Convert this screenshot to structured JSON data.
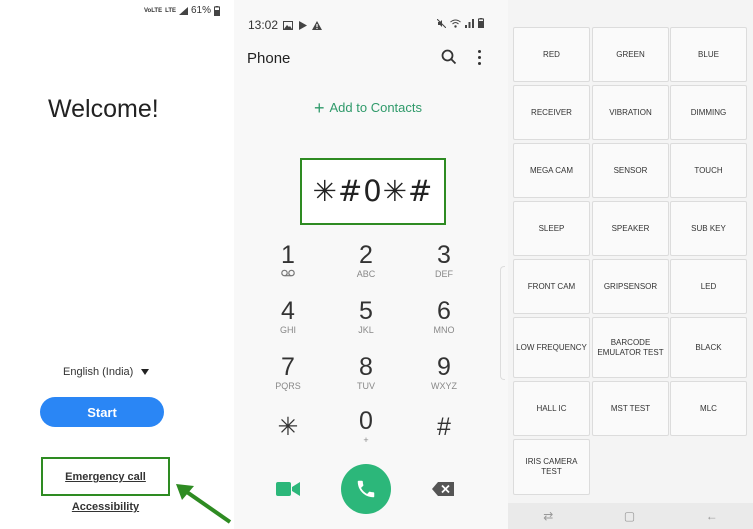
{
  "welcome": {
    "status": {
      "sim_tiny_1": "VoLTE",
      "sim_tiny_2": "LTE",
      "signal_icon": "signal-icon",
      "battery_percent": "61%"
    },
    "title": "Welcome!",
    "language": "English (India)",
    "start_label": "Start",
    "emergency_label": "Emergency call",
    "accessibility_label": "Accessibility"
  },
  "phone": {
    "status": {
      "time": "13:02",
      "left_icons": [
        "image-icon",
        "play-store-icon",
        "warning-icon"
      ],
      "right_icons": [
        "mute-icon",
        "wifi-icon",
        "signal-icon",
        "battery-icon"
      ]
    },
    "app_title": "Phone",
    "add_to_contacts": "Add to Contacts",
    "dialed": "✳#0✳#",
    "keys": [
      {
        "digit": "1",
        "letters": ""
      },
      {
        "digit": "2",
        "letters": "ABC"
      },
      {
        "digit": "3",
        "letters": "DEF"
      },
      {
        "digit": "4",
        "letters": "GHI"
      },
      {
        "digit": "5",
        "letters": "JKL"
      },
      {
        "digit": "6",
        "letters": "MNO"
      },
      {
        "digit": "7",
        "letters": "PQRS"
      },
      {
        "digit": "8",
        "letters": "TUV"
      },
      {
        "digit": "9",
        "letters": "WXYZ"
      },
      {
        "digit": "✳",
        "letters": ""
      },
      {
        "digit": "0",
        "letters": "+"
      },
      {
        "digit": "#",
        "letters": ""
      }
    ],
    "accent": "#2cb77a"
  },
  "tests": {
    "tiles": [
      "RED",
      "GREEN",
      "BLUE",
      "RECEIVER",
      "VIBRATION",
      "DIMMING",
      "MEGA CAM",
      "SENSOR",
      "TOUCH",
      "SLEEP",
      "SPEAKER",
      "SUB KEY",
      "FRONT CAM",
      "GRIPSENSOR",
      "LED",
      "LOW FREQUENCY",
      "BARCODE EMULATOR TEST",
      "BLACK",
      "HALL IC",
      "MST TEST",
      "MLC",
      "IRIS CAMERA TEST"
    ],
    "nav": {
      "recent": "⇄",
      "home": "▢",
      "back": "←"
    }
  },
  "colors": {
    "highlight": "#2e8b22",
    "start_button": "#2a86f5"
  }
}
